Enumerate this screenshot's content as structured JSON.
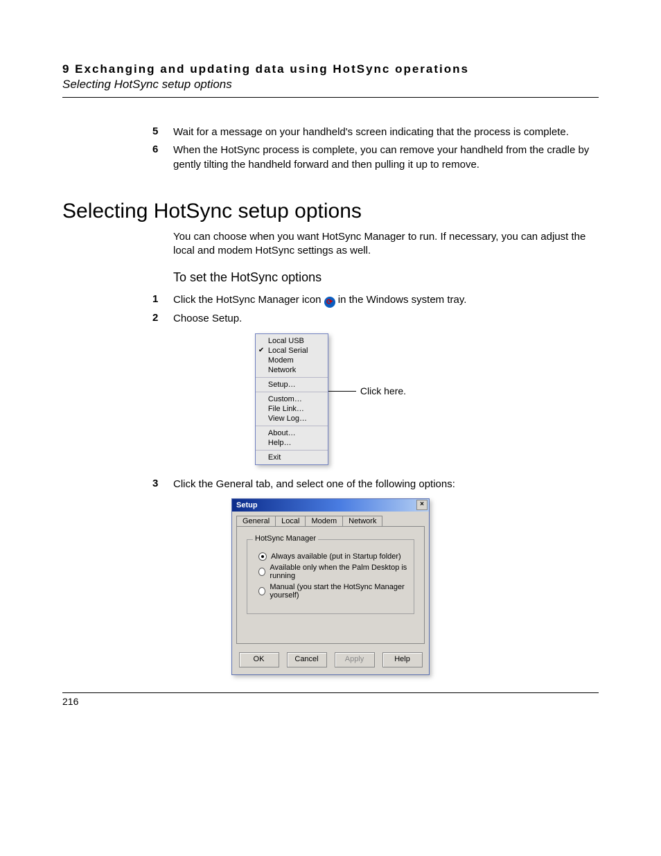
{
  "header": {
    "chapter": "9  Exchanging and updating data using HotSync operations",
    "section": "Selecting HotSync setup options"
  },
  "steps_top": [
    {
      "num": "5",
      "text": "Wait for a message on your handheld's screen indicating that the process is complete."
    },
    {
      "num": "6",
      "text": "When the HotSync process is complete, you can remove your handheld from the cradle by gently tilting the handheld forward and then pulling it up to remove."
    }
  ],
  "section_title": "Selecting HotSync setup options",
  "intro_para": "You can choose when you want HotSync Manager to run. If necessary, you can adjust the local and modem HotSync settings as well.",
  "subhead": "To set the HotSync options",
  "steps_options": [
    {
      "num": "1",
      "pre": "Click the HotSync Manager icon ",
      "post": " in the Windows system tray."
    },
    {
      "num": "2",
      "text": "Choose Setup."
    }
  ],
  "context_menu": {
    "groups": [
      [
        {
          "label": "Local USB",
          "checked": false
        },
        {
          "label": "Local Serial",
          "checked": true
        },
        {
          "label": "Modem",
          "checked": false
        },
        {
          "label": "Network",
          "checked": false
        }
      ],
      [
        {
          "label": "Setup…",
          "checked": false
        }
      ],
      [
        {
          "label": "Custom…",
          "checked": false
        },
        {
          "label": "File Link…",
          "checked": false
        },
        {
          "label": "View Log…",
          "checked": false
        }
      ],
      [
        {
          "label": "About…",
          "checked": false
        },
        {
          "label": "Help…",
          "checked": false
        }
      ],
      [
        {
          "label": "Exit",
          "checked": false
        }
      ]
    ],
    "callout": "Click here."
  },
  "step3": {
    "num": "3",
    "text": "Click the General tab, and select one of the following options:"
  },
  "setup_dialog": {
    "title": "Setup",
    "close": "×",
    "tabs": [
      "General",
      "Local",
      "Modem",
      "Network"
    ],
    "active_tab": 0,
    "fieldset_title": "HotSync Manager",
    "radios": [
      {
        "label": "Always available (put in Startup folder)",
        "selected": true
      },
      {
        "label": "Available only when the Palm Desktop is running",
        "selected": false
      },
      {
        "label": "Manual (you start the HotSync Manager yourself)",
        "selected": false
      }
    ],
    "buttons": [
      {
        "label": "OK",
        "disabled": false
      },
      {
        "label": "Cancel",
        "disabled": false
      },
      {
        "label": "Apply",
        "disabled": true
      },
      {
        "label": "Help",
        "disabled": false
      }
    ]
  },
  "page_number": "216"
}
